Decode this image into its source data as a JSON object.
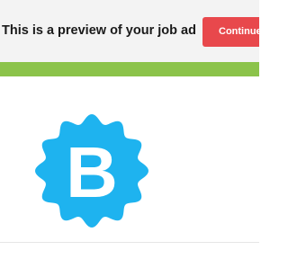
{
  "header": {
    "preview_text": "This is a preview of your job ad",
    "continue_label": "Continue"
  },
  "company": {
    "logo_letter": "B"
  },
  "colors": {
    "header_bg": "#f3f3f3",
    "continue_button": "#e8484c",
    "accent_stripe": "#8bc34a",
    "logo_blue": "#1eb3ef"
  },
  "icons": {
    "logo": "company-logo-badge-icon"
  }
}
